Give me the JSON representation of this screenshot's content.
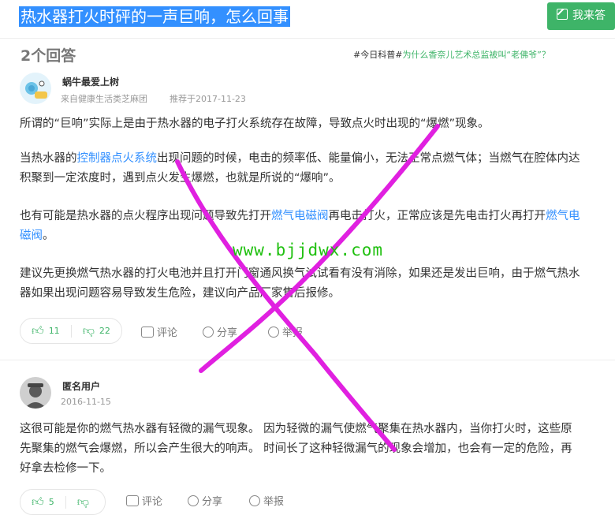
{
  "page": {
    "title": "热水器打火时砰的一声巨响，怎么回事",
    "ask_button": "我来答"
  },
  "answers_header": {
    "count_label": "2个回答"
  },
  "promo": {
    "tag": "#今日科普#",
    "link": "为什么香奈儿艺术总监被叫“老佛爷”？"
  },
  "answers": [
    {
      "username": "蜗牛最爱上树",
      "source": "来自健康生活类芝麻团",
      "recommend": "推荐于2017-11-23",
      "paragraphs": [
        [
          "所谓的“巨响”实际上是由于热水器的电子打火系统存在故障，导致点火时出现的“爆燃”现象。"
        ],
        [
          "当热水器的",
          "控制器点火系统",
          "出现问题的时候，电击的频率低、能量偏小，无法正常点燃气体；当燃气在腔体内达积聚到一定浓度时，遇到点火发生爆燃，也就是所说的“爆响”。"
        ],
        [
          "也有可能是热水器的点火程序出现问题导致先打开",
          "燃气电磁阀",
          "再电击打火，正常应该是先电击打火再打开",
          "燃气电磁阀",
          "。"
        ],
        [
          "建议先更换燃气热水器的打火电池并且打开门窗通风换气试试看有没有消除，如果还是发出巨响，由于燃气热水器如果出现问题容易导致发生危险，建议向产品厂家售后报修。"
        ]
      ],
      "likes": "11",
      "dislikes": "22",
      "actions": {
        "comment": "评论",
        "share": "分享",
        "report": "举报"
      }
    },
    {
      "username": "匿名用户",
      "date": "2016-11-15",
      "paragraphs": [
        [
          "这很可能是你的燃气热水器有轻微的漏气现象。 因为轻微的漏气使燃气聚集在热水器内，当你打火时，这些原先聚集的燃气会爆燃，所以会产生很大的响声。 时间长了这种轻微漏气的现象会增加，也会有一定的危险，再好拿去检修一下。"
        ]
      ],
      "likes": "5",
      "actions": {
        "comment": "评论",
        "share": "分享",
        "report": "举报"
      }
    }
  ],
  "watermark": "www.bjjdwx.com",
  "colors": {
    "accent_green": "#3eb468",
    "link_blue": "#3390ff",
    "overlay_magenta": "#e020e0",
    "watermark_green": "#20c010"
  }
}
